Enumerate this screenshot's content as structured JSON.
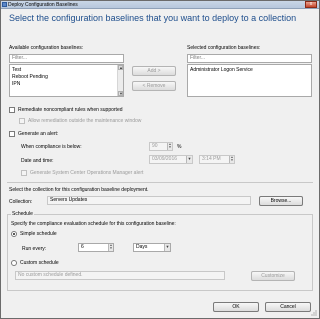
{
  "window": {
    "title": "Deploy Configuration Baselines",
    "close_glyph": "x"
  },
  "heading": "Select the configuration baselines that you want to deploy to a collection",
  "available": {
    "label": "Available configuration baselines:",
    "filter_placeholder": "Filter...",
    "items": [
      "Test",
      "Reboot Pending",
      "IPN"
    ]
  },
  "selected": {
    "label": "Selected configuration baselines:",
    "filter_placeholder": "Filter...",
    "items": [
      "Administrator Logon Service"
    ]
  },
  "buttons": {
    "add": "Add >",
    "remove": "< Remove",
    "browse": "Browse...",
    "customize": "Customize",
    "ok": "OK",
    "cancel": "Cancel"
  },
  "options": {
    "remediate": "Remediate noncompliant rules when supported",
    "allow_remediation": "Allow remediation outside the maintenance window",
    "generate_alert": "Generate an alert:",
    "compliance_below": "When compliance is below:",
    "compliance_value": "90",
    "percent": "%",
    "date_time_label": "Date and time:",
    "date_value": "03/09/2016",
    "time_value": "3:14 PM",
    "scom_alert": "Generate System Center Operations Manager alert"
  },
  "collection": {
    "prompt": "Select the collection for this configuration baseline deployment.",
    "label": "Collection:",
    "value": "Servers Updates"
  },
  "schedule": {
    "group_title": "Schedule",
    "description": "Specify the compliance evaluation schedule for this configuration baseline:",
    "simple": "Simple schedule",
    "run_every": "Run every:",
    "interval_value": "6",
    "unit_value": "Days",
    "custom": "Custom schedule",
    "custom_placeholder": "No custom schedule defined."
  }
}
